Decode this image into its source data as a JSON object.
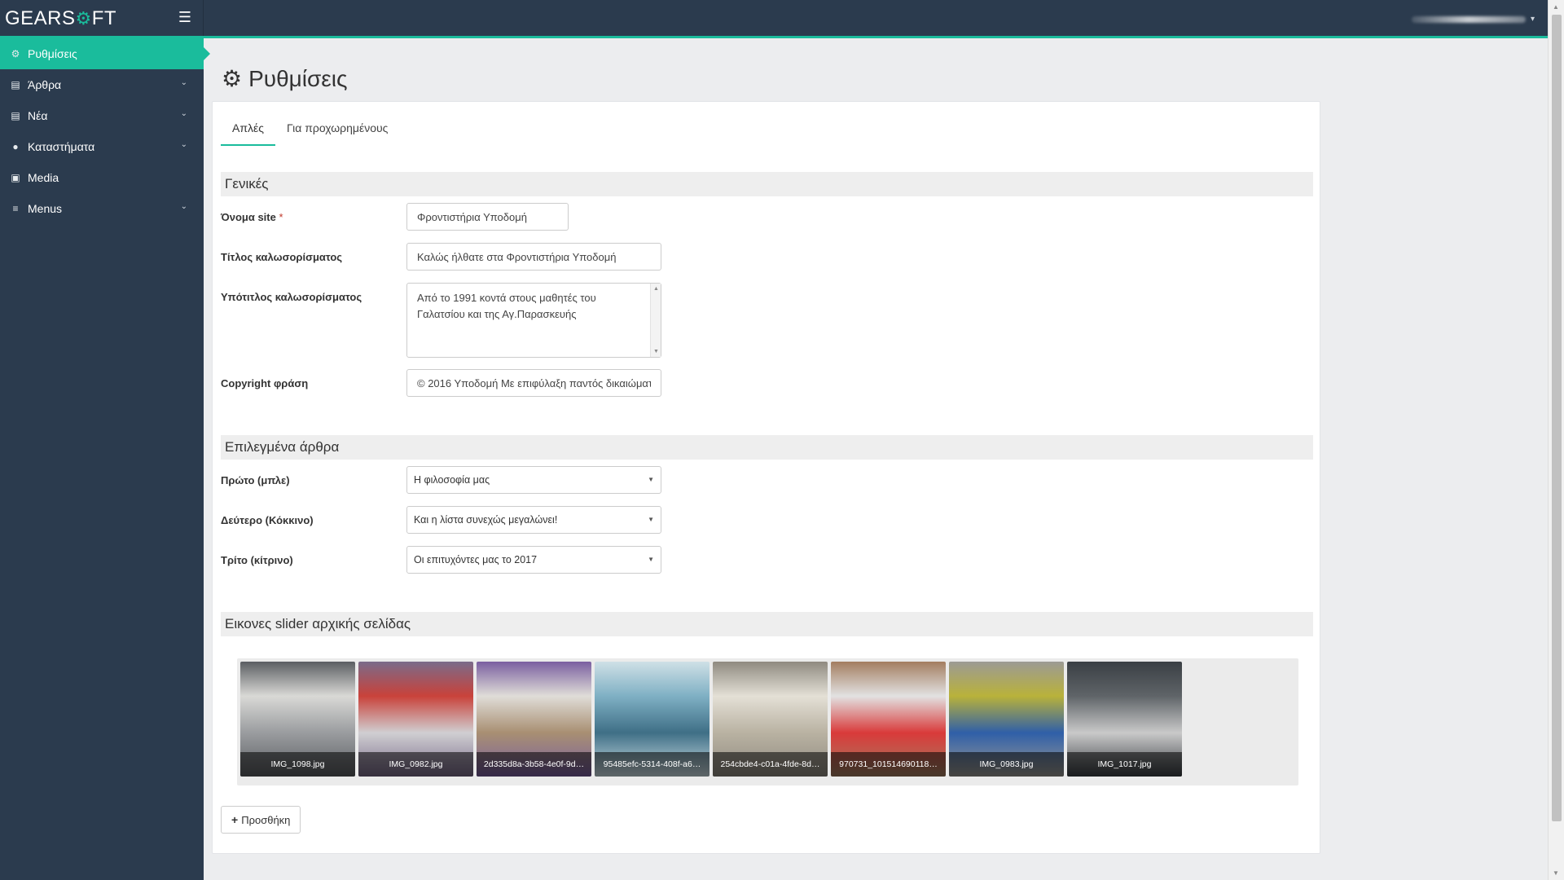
{
  "brand": {
    "logo_left": "GEARS",
    "logo_gear": "⚙",
    "logo_right": "FT"
  },
  "topbar": {
    "menu_icon": "hamburger-icon",
    "user_caret": "▾"
  },
  "sidebar": {
    "items": [
      {
        "label": "Ρυθμίσεις",
        "icon": "cogs-icon",
        "glyph": "⚙",
        "active": true,
        "chevron": ""
      },
      {
        "label": "Άρθρα",
        "icon": "file-icon",
        "glyph": "▤",
        "active": false,
        "chevron": "⌄"
      },
      {
        "label": "Νέα",
        "icon": "file-icon",
        "glyph": "▤",
        "active": false,
        "chevron": "⌄"
      },
      {
        "label": "Καταστήματα",
        "icon": "map-marker-icon",
        "glyph": "●",
        "active": false,
        "chevron": "⌄"
      },
      {
        "label": "Media",
        "icon": "image-icon",
        "glyph": "▣",
        "active": false,
        "chevron": ""
      },
      {
        "label": "Menus",
        "icon": "list-icon",
        "glyph": "≡",
        "active": false,
        "chevron": "⌄"
      }
    ]
  },
  "page": {
    "title": "Ρυθμίσεις",
    "title_icon": "⚙"
  },
  "tabs": [
    {
      "label": "Απλές",
      "active": true
    },
    {
      "label": "Για προχωρημένους",
      "active": false
    }
  ],
  "sections": {
    "general": "Γενικές",
    "featured": "Επιλεγμένα άρθρα",
    "slider": "Εικονες slider αρχικής σελίδας"
  },
  "fields": {
    "site_name": {
      "label": "Όνομα site",
      "required_mark": "*",
      "value": "Φροντιστήρια Υποδομή"
    },
    "welcome_title": {
      "label": "Τίτλος καλωσορίσματος",
      "value": "Καλώς ήλθατε στα Φροντιστήρια Υποδομή"
    },
    "welcome_subtitle": {
      "label": "Υπότιτλος καλωσορίσματος",
      "value": "Από το 1991 κοντά στους μαθητές του Γαλατσίου και της Αγ.Παρασκευής"
    },
    "copyright": {
      "label": "Copyright φράση",
      "value": "© 2016 Υποδομή Με επιφύλαξη παντός δικαιώματος"
    },
    "first": {
      "label": "Πρώτο (μπλε)",
      "value": "Η φιλοσοφία μας"
    },
    "second": {
      "label": "Δεύτερο (Κόκκινο)",
      "value": "Και η λίστα συνεχώς μεγαλώνει!"
    },
    "third": {
      "label": "Τρίτο (κίτρινο)",
      "value": "Οι επιτυχόντες μας το 2017"
    }
  },
  "slider_images": [
    {
      "name": "IMG_1098.jpg",
      "colors": [
        "#d9d9d6",
        "#9a9c9f",
        "#5b5e62"
      ]
    },
    {
      "name": "IMG_0982.jpg",
      "colors": [
        "#c9423a",
        "#d0cfd2",
        "#7a6b8a"
      ]
    },
    {
      "name": "2d335d8a-3b58-4e0f-9d…",
      "colors": [
        "#e0ddd8",
        "#a88f72",
        "#7a5fa0"
      ]
    },
    {
      "name": "95485efc-5314-408f-a6…",
      "colors": [
        "#7fb0c4",
        "#3f6f86",
        "#cfe0e6"
      ]
    },
    {
      "name": "254cbde4-c01a-4fde-8d…",
      "colors": [
        "#e4e0d6",
        "#b9b2a2",
        "#8f8a80"
      ]
    },
    {
      "name": "970731_101514690118…",
      "colors": [
        "#e2e2e2",
        "#d93a3a",
        "#a37d60"
      ]
    },
    {
      "name": "IMG_0983.jpg",
      "colors": [
        "#b9b23a",
        "#2f5fa8",
        "#9c9a94"
      ]
    },
    {
      "name": "IMG_1017.jpg",
      "colors": [
        "#5f6468",
        "#c9c9c9",
        "#3a3f44"
      ]
    }
  ],
  "add_button": {
    "label": "Προσθήκη",
    "icon": "plus-icon",
    "glyph": "+"
  }
}
